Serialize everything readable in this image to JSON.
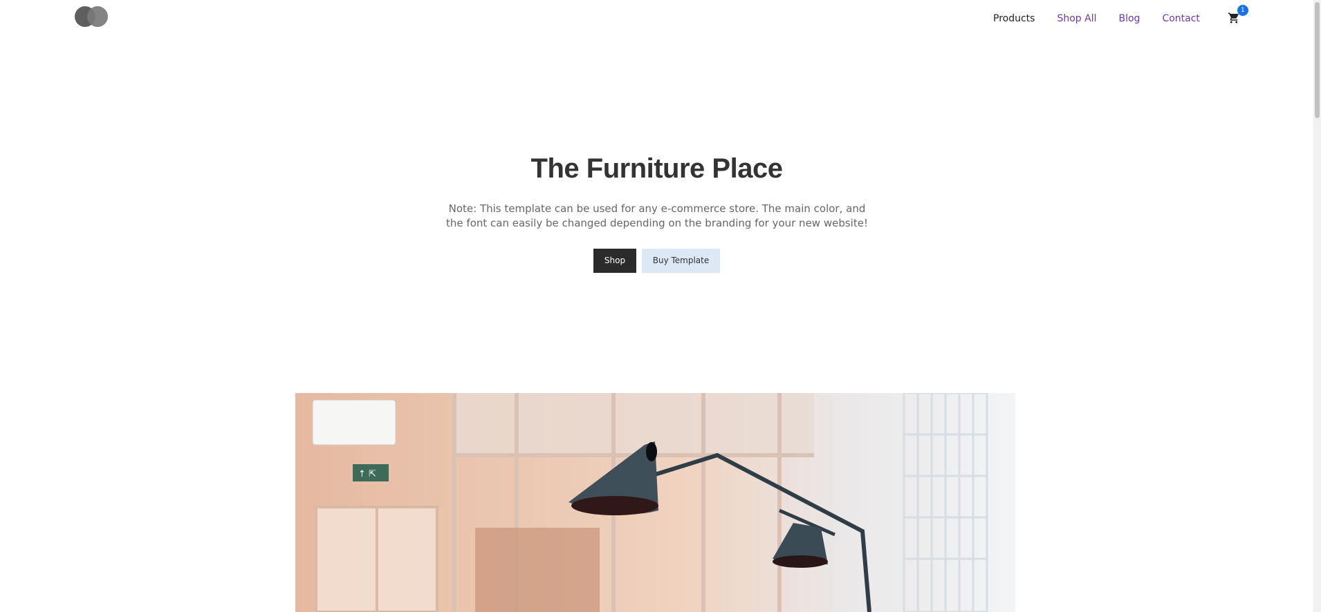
{
  "nav": {
    "items": [
      {
        "label": "Products",
        "active": true
      },
      {
        "label": "Shop All",
        "active": false
      },
      {
        "label": "Blog",
        "active": false
      },
      {
        "label": "Contact",
        "active": false
      }
    ],
    "cart_count": "1"
  },
  "hero": {
    "title": "The Furniture Place",
    "note": "Note: This template can be used for any e-commerce store. The main color, and the font can easily be changed depending on the branding for your new website!",
    "shop_label": "Shop",
    "buy_label": "Buy Template"
  },
  "colors": {
    "accent": "#6a38b0",
    "dark_button": "#2b2b2b",
    "light_button": "#dce8f5",
    "badge": "#1a73e8"
  },
  "icons": {
    "logo": "overlapping-circles-logo",
    "cart": "cart-icon"
  }
}
